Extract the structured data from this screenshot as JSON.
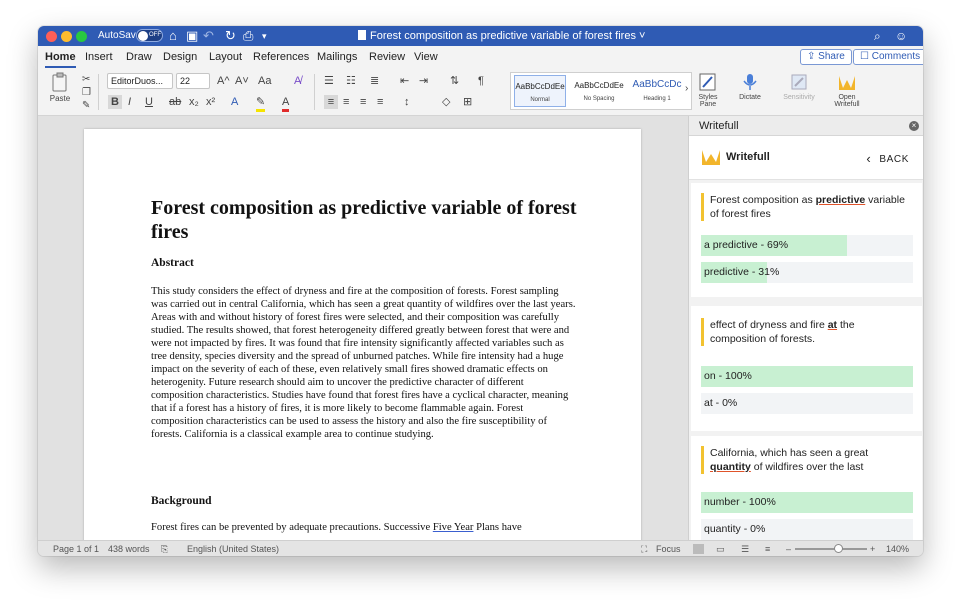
{
  "window": {
    "title": "Forest composition as predictive variable of forest fires",
    "autosave_label": "AutoSave",
    "autosave_state": "OFF"
  },
  "colors": {
    "accent": "#2f5bb4",
    "highlight_green": "#c8f0d2",
    "quote_bar": "#f2c230",
    "error_underline": "#e0532a"
  },
  "tabs": [
    {
      "label": "Home",
      "active": true
    },
    {
      "label": "Insert"
    },
    {
      "label": "Draw"
    },
    {
      "label": "Design"
    },
    {
      "label": "Layout"
    },
    {
      "label": "References"
    },
    {
      "label": "Mailings"
    },
    {
      "label": "Review"
    },
    {
      "label": "View"
    }
  ],
  "header_actions": {
    "share": "Share",
    "comments": "Comments"
  },
  "ribbon": {
    "paste_label": "Paste",
    "font_name": "EditorDuos...",
    "font_size": "22",
    "bold": "B",
    "italic": "I",
    "underline": "U",
    "strike": "ab",
    "subscript": "x₂",
    "superscript": "x²",
    "grow_font": "A^",
    "shrink_font": "A˅",
    "change_case": "Aa",
    "styles": [
      {
        "sample": "AaBbCcDdEe",
        "name": "Normal"
      },
      {
        "sample": "AaBbCcDdEe",
        "name": "No Spacing"
      },
      {
        "sample": "AaBbCcDc",
        "name": "Heading 1"
      }
    ],
    "styles_pane_label": "Styles Pane",
    "dictate_label": "Dictate",
    "sensitivity_label": "Sensitivity",
    "open_writefull_label": "Open Writefull"
  },
  "document": {
    "title": "Forest composition as predictive variable of forest fires",
    "abstract_heading": "Abstract",
    "abstract_text": "This study considers the effect of dryness and fire at the composition of forests. Forest sampling was carried out in central California, which has seen a great quantity of wildfires over the last years. Areas with and without history of forest fires were selected, and their composition was carefully studied. The results showed, that forest heterogeneity differed greatly between forest that were and were not impacted by fires. It was found that fire intensity significantly affected variables such as tree density, species diversity and the spread of unburned patches. While fire intensity had a huge impact on the severity of each of these, even relatively small fires showed dramatic effects on heterogenity. Future research should aim to uncover the predictive character of different composition characteristics. Studies have found that forest fires have a cyclical character, meaning that if a forest has a history of fires, it is more likely to become flammable again. Forest composition characteristics can be used to assess the history and also the fire susceptibility of forests. California is a classical example area to continue studying.",
    "background_heading": "Background",
    "background_text_before": "Forest fires can be prevented by adequate precautions. Successive ",
    "background_link": "Five Year",
    "background_text_after": " Plans have"
  },
  "writefull": {
    "pane_title": "Writefull",
    "brand": "Writefull",
    "back_label": "BACK",
    "suggestions": [
      {
        "before": "Forest composition as ",
        "highlight": "predictive",
        "after": " variable of forest fires",
        "options": [
          {
            "label": "a predictive - 69%",
            "share": 0.69
          },
          {
            "label": "predictive - 31%",
            "share": 0.31
          }
        ]
      },
      {
        "before": "effect of dryness and fire ",
        "highlight": "at",
        "after": " the composition of forests.",
        "options": [
          {
            "label": "on - 100%",
            "share": 1.0
          },
          {
            "label": "at - 0%",
            "share": 0.0
          }
        ]
      },
      {
        "before": "California, which has seen a great ",
        "highlight": "quantity",
        "after": " of wildfires over the last",
        "options": [
          {
            "label": "number - 100%",
            "share": 1.0
          },
          {
            "label": "quantity - 0%",
            "share": 0.0
          }
        ]
      }
    ]
  },
  "statusbar": {
    "page": "Page 1 of 1",
    "words": "438 words",
    "language": "English (United States)",
    "focus": "Focus",
    "zoom_minus": "–",
    "zoom_plus": "+",
    "zoom": "140%",
    "zoom_level": 0.6
  }
}
